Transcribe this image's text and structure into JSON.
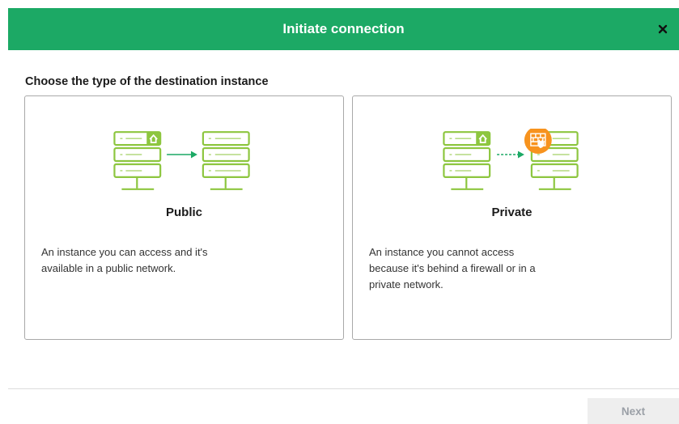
{
  "header": {
    "title": "Initiate connection",
    "close_icon": "close-icon"
  },
  "subtitle": "Choose the type of the destination instance",
  "cards": [
    {
      "title": "Public",
      "description": "An instance you can access and it's available in a public network.",
      "illustration": "server-to-server-arrow"
    },
    {
      "title": "Private",
      "description": "An instance you cannot access because it's behind a firewall or in a private network.",
      "illustration": "server-firewall-dashed-arrow"
    }
  ],
  "footer": {
    "next_label": "Next"
  },
  "colors": {
    "accent": "#1ca965",
    "server": "#8dc63f",
    "arrow": "#1ca965",
    "firewall": "#f7931e"
  }
}
